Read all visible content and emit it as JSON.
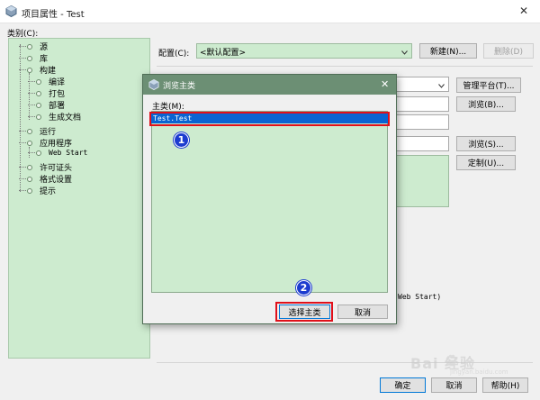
{
  "window": {
    "title": "项目属性 - Test",
    "close_glyph": "✕"
  },
  "categories": {
    "label": "类别(C):",
    "items": [
      {
        "label": "源"
      },
      {
        "label": "库"
      },
      {
        "label": "构建"
      },
      {
        "label": "编译"
      },
      {
        "label": "打包"
      },
      {
        "label": "部署"
      },
      {
        "label": "生成文档"
      },
      {
        "label": "运行"
      },
      {
        "label": "应用程序"
      },
      {
        "label": "Web Start"
      },
      {
        "label": "许可证头"
      },
      {
        "label": "格式设置"
      },
      {
        "label": "提示"
      }
    ]
  },
  "config": {
    "label": "配置(C):",
    "value": "<默认配置>",
    "new_button": "新建(N)...",
    "delete_button": "删除(D)"
  },
  "right_buttons": {
    "manage_platforms": "管理平台(T)...",
    "browse1": "浏览(B)...",
    "browse2": "浏览(S)...",
    "customize": "定制(U)..."
  },
  "partial_text": "Web Start)",
  "footer": {
    "ok": "确定",
    "cancel": "取消",
    "help": "帮助(H)"
  },
  "dialog": {
    "title": "浏览主类",
    "close_glyph": "✕",
    "list_label": "主类(M):",
    "items": [
      "Test.Test"
    ],
    "select_button": "选择主类",
    "cancel_button": "取消"
  },
  "annotations": {
    "step1": "1",
    "step2": "2"
  },
  "watermark": {
    "text": "Bai 经验",
    "sub": "jingyan.baidu.com"
  },
  "colors": {
    "selection": "#0a64d2",
    "highlight_box": "#e0101a",
    "panel_green": "#cdebcf",
    "dialog_title_bar": "#6c8f74"
  }
}
